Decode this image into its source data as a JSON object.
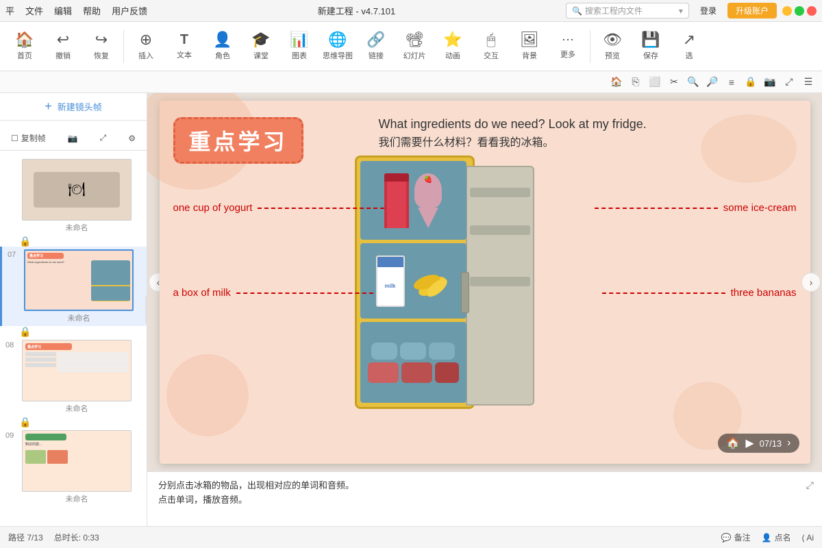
{
  "app": {
    "title": "新建工程 - v4.7.101",
    "search_placeholder": "搜索工程内文件",
    "login_label": "登录",
    "upgrade_label": "升级账户"
  },
  "menu": {
    "items": [
      "平",
      "文件",
      "编辑",
      "帮助",
      "用户反馈"
    ]
  },
  "toolbar": {
    "items": [
      {
        "id": "home",
        "label": "首页",
        "icon": "🏠"
      },
      {
        "id": "undo",
        "label": "撤销",
        "icon": "↩"
      },
      {
        "id": "redo",
        "label": "恢复",
        "icon": "↪"
      },
      {
        "id": "insert",
        "label": "插入",
        "icon": "⊕"
      },
      {
        "id": "text",
        "label": "文本",
        "icon": "T"
      },
      {
        "id": "role",
        "label": "角色",
        "icon": "👤"
      },
      {
        "id": "class",
        "label": "课堂",
        "icon": "🎓"
      },
      {
        "id": "chart",
        "label": "图表",
        "icon": "📊"
      },
      {
        "id": "mindmap",
        "label": "思维导图",
        "icon": "🌐"
      },
      {
        "id": "link",
        "label": "链接",
        "icon": "🔗"
      },
      {
        "id": "slides",
        "label": "幻灯片",
        "icon": "📽"
      },
      {
        "id": "animation",
        "label": "动画",
        "icon": "⭐"
      },
      {
        "id": "interact",
        "label": "交互",
        "icon": "🖱"
      },
      {
        "id": "bg",
        "label": "背景",
        "icon": "🖼"
      },
      {
        "id": "more",
        "label": "更多",
        "icon": "⋯"
      },
      {
        "id": "preview",
        "label": "预览",
        "icon": "👁"
      },
      {
        "id": "save",
        "label": "保存",
        "icon": "💾"
      },
      {
        "id": "select",
        "label": "选",
        "icon": "↗"
      }
    ]
  },
  "panel": {
    "new_frame_label": "新建镜头帧",
    "copy_frame_label": "复制帧",
    "slides": [
      {
        "num": "",
        "label": "未命名",
        "type": "prev"
      },
      {
        "num": "07",
        "label": "未命名",
        "type": "active"
      },
      {
        "num": "08",
        "label": "未命名",
        "type": "normal"
      },
      {
        "num": "09",
        "label": "未命名",
        "type": "last"
      }
    ]
  },
  "slide": {
    "title": "重点学习",
    "main_text_line1": "What ingredients do we need? Look at my fridge.",
    "main_text_line2": "我们需要什么材料？看看我的冰箱。",
    "labels": {
      "yogurt": "one cup of yogurt",
      "ice_cream": "some ice-cream",
      "milk": "a box of milk",
      "bananas": "three bananas"
    }
  },
  "notes": {
    "line1": "分别点击冰箱的物品，出现相对应的单词和音频。",
    "line2": "点击单词，播放音频。"
  },
  "status": {
    "path": "路径 7/13",
    "duration": "总时长: 0:33",
    "comment_label": "备注",
    "bookmark_label": "点名",
    "ai_label": "( Ai"
  },
  "page_counter": {
    "current": "07",
    "total": "13",
    "display": "07/13"
  },
  "colors": {
    "accent": "#4a90d9",
    "title_bg": "#f08060",
    "red_label": "#cc0000",
    "fridge_yellow": "#e8c040",
    "fridge_compartment": "#6b9aaa"
  }
}
